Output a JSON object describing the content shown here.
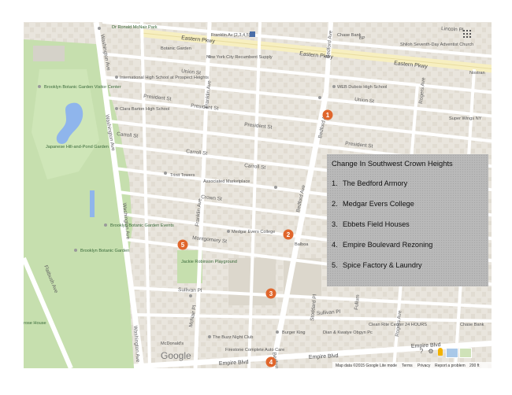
{
  "legend": {
    "title": "Change In Southwest Crown Heights",
    "items": [
      {
        "num": "1.",
        "label": "The Bedford Armory"
      },
      {
        "num": "2.",
        "label": "Medgar Evers College"
      },
      {
        "num": "3.",
        "label": "Ebbets Field Houses"
      },
      {
        "num": "4.",
        "label": "Empire Boulevard Rezoning"
      },
      {
        "num": "5.",
        "label": "Spice Factory & Laundry"
      }
    ]
  },
  "markers": [
    "1",
    "2",
    "3",
    "4",
    "5"
  ],
  "colors": {
    "marker": "#e0662c",
    "park": "#c6dfae",
    "water": "#8fb5ec",
    "land": "#ebe7df",
    "block": "#e4dfd6",
    "road": "#ffffff",
    "parkway": "#f7efc0"
  },
  "streets": {
    "eastern_pkwy_1": "Eastern Pkwy",
    "eastern_pkwy_2": "Eastern Pkwy",
    "eastern_pkwy_3": "Eastern Pkwy",
    "union_st_1": "Union St",
    "union_st_2": "Union St",
    "president_st_1": "President St",
    "president_st_2": "President St",
    "president_st_3": "President St",
    "president_st_4": "President St",
    "carroll_st_1": "Carroll St",
    "carroll_st_2": "Carroll St",
    "carroll_st_3": "Carroll St",
    "crown_st": "Crown St",
    "montgomery_st": "Montgomery St",
    "sullivan_pl_1": "Sullivan Pl",
    "sullivan_pl_2": "Sullivan Pl",
    "mcnair_pl": "McNair Pl",
    "empire_blvd_1": "Empire Blvd",
    "empire_blvd_2": "Empire Blvd",
    "empire_blvd_3": "Empire Blvd",
    "washington_ave_1": "Washington Ave",
    "washington_ave_2": "Washington Ave",
    "washington_ave_3": "Washington Ave",
    "washington_ave_4": "Washington Ave",
    "franklin_ave_1": "Franklin Ave",
    "franklin_ave_2": "Franklin Ave",
    "bedford_ave_1": "Bedford Ave",
    "bedford_ave_2": "Bedford Ave",
    "bedford_ave_3": "Bedford Ave",
    "bedford_ave_4": "Bedford Ave",
    "rogers_ave_1": "Rogers Ave",
    "rogers_ave_2": "Rogers Ave",
    "flatbush_ave": "Flatbush Ave",
    "lincoln_pl": "Lincoln Pl",
    "mcnair_park": "Dr Ronald McNair Park",
    "stoddard_pl": "Stoddard Pl",
    "fullum": "Fullum"
  },
  "pois": {
    "franklin_station": "Franklin Av [2,3,4,5]",
    "botanic_garden_station": "Botanic Garden",
    "nyc_recumbent": "New York City Recumbent Supply",
    "intl_high_school": "International High School at Prospect Heights",
    "brooklyn_botanic_visitor": "Brooklyn Botanic Garden Visitor Center",
    "clara_barton": "Clara Barton High School",
    "japanese_garden": "Japanese Hill-and-Pond Garden",
    "chase_bank_1": "Chase Bank",
    "bp": "BP",
    "shiloh": "Shiloh Seventh-Day Adventist Church",
    "web_dubois": "WEB Dubois High School",
    "super_wings": "Super Wings NY",
    "trinit_towers": "Trinit Towers",
    "associated_marketplace": "Associated Marketplace",
    "medgar_evers_poi": "Medgar Evers College",
    "brooklyn_botanic_events": "Brooklyn Botanic Garden Events",
    "brooklyn_botanic_garden": "Brooklyn Botanic Garden",
    "jackie_robinson": "Jackie Robinson Playground",
    "balboa": "Balboa",
    "buzz_night_club": "The Buzz Night Club",
    "firestone": "Firestone Complete Auto Care",
    "mcdonalds": "McDonald's",
    "burger_king": "Burger King",
    "dian_kwatye": "Dian & Kwatye Obgyn Pc",
    "clean_rite": "Clean Rite Center 24 HOURS",
    "chase_bank_2": "Chase Bank",
    "rose_house": "rose House",
    "nostrand": "Nostran"
  },
  "google_logo": "Google",
  "attribution": {
    "map_data": "Map data ©2015 Google",
    "lite_mode": "Lite mode",
    "terms": "Terms",
    "privacy": "Privacy",
    "report": "Report a problem",
    "scale": "200 ft"
  },
  "controls": {
    "help": "?",
    "settings": "⚙"
  }
}
